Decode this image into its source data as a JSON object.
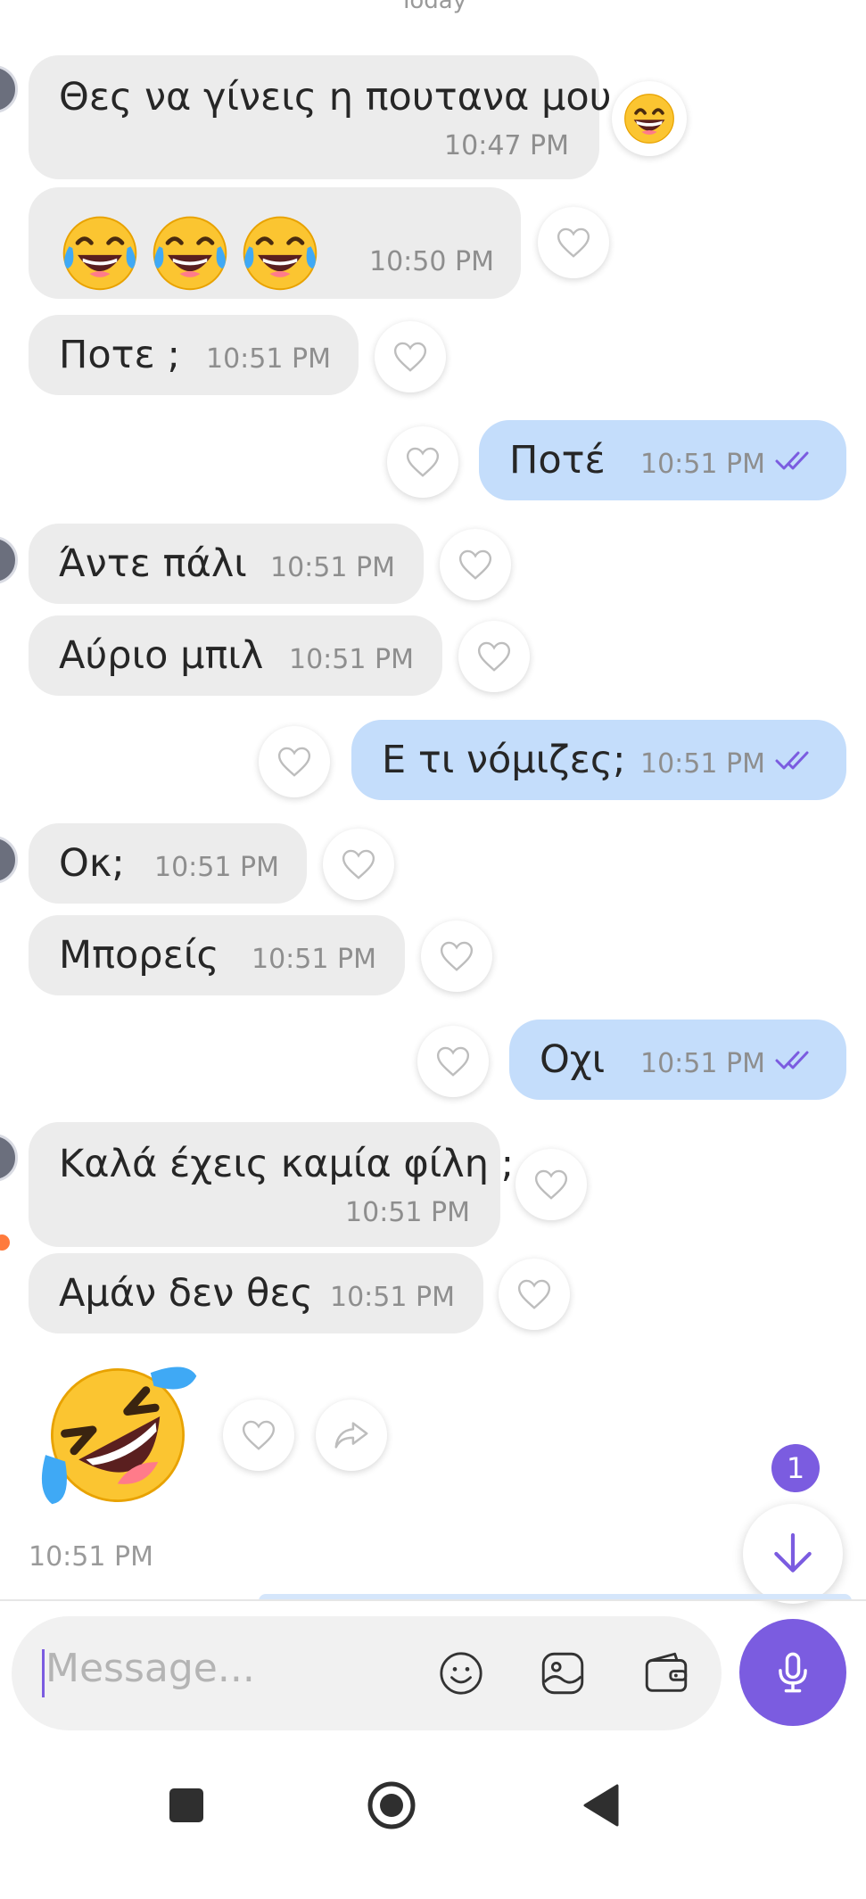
{
  "chat": {
    "date_separator": "Today",
    "messages": [
      {
        "direction": "in",
        "text": "Θες να γίνεις η πουτανα μου ;",
        "time": "10:47 PM",
        "reaction": "grinning-face-emoji"
      },
      {
        "direction": "in",
        "text": "😂😂😂",
        "time": "10:50 PM"
      },
      {
        "direction": "in",
        "text": "Ποτε ;",
        "time": "10:51 PM"
      },
      {
        "direction": "out",
        "text": "Ποτέ",
        "time": "10:51 PM",
        "status": "read"
      },
      {
        "direction": "in",
        "text": "Άντε πάλι",
        "time": "10:51 PM"
      },
      {
        "direction": "in",
        "text": "Αύριο μπιλ",
        "time": "10:51 PM"
      },
      {
        "direction": "out",
        "text": "Ε τι νόμιζες;",
        "time": "10:51 PM",
        "status": "read"
      },
      {
        "direction": "in",
        "text": "Οκ;",
        "time": "10:51 PM"
      },
      {
        "direction": "in",
        "text": "Μπορείς",
        "time": "10:51 PM"
      },
      {
        "direction": "out",
        "text": "Οχι",
        "time": "10:51 PM",
        "status": "read"
      },
      {
        "direction": "in",
        "text": "Καλά έχεις καμία φίλη ;",
        "time": "10:51 PM"
      },
      {
        "direction": "in",
        "text": "Αμάν δεν θες",
        "time": "10:51 PM"
      },
      {
        "direction": "in",
        "text": "🤣",
        "time": "10:51 PM"
      }
    ]
  },
  "scroll_to_bottom": {
    "unread_count": "1",
    "icon": "arrow-down-icon"
  },
  "composer": {
    "placeholder": "Message...",
    "icons": [
      "emoji-icon",
      "gallery-icon",
      "wallet-icon"
    ],
    "mic_icon": "microphone-icon"
  },
  "navigation": {
    "icons": [
      "recent-apps-icon",
      "home-icon",
      "back-icon"
    ]
  },
  "colors": {
    "accent": "#7b5ce0",
    "incoming_bubble": "#ececec",
    "outgoing_bubble": "#c4ddfb",
    "unread_dot": "#ff7a3c"
  }
}
